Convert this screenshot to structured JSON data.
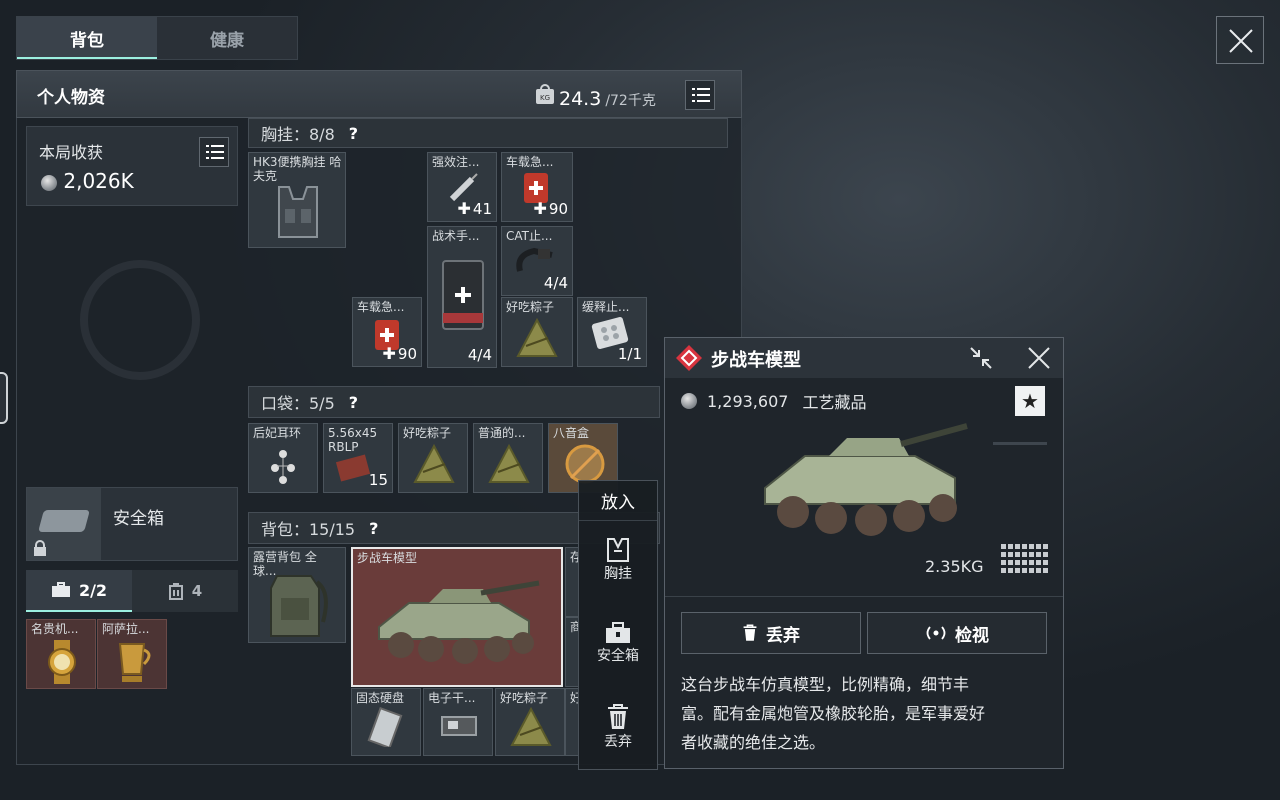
{
  "tabs": {
    "backpack": "背包",
    "health": "健康"
  },
  "header": {
    "title": "个人物资",
    "weight": "24.3",
    "weight_cap": "/72千克",
    "weight_icon": "kg-weight-icon"
  },
  "harvest": {
    "title": "本局收获",
    "value": "2,026K"
  },
  "chest_rig": {
    "label": "胸挂：8/8",
    "help": "?"
  },
  "chest_items": [
    {
      "name": "HK3便携胸挂 哈夫克",
      "count": ""
    },
    {
      "name": "强效注...",
      "count": "41"
    },
    {
      "name": "车载急...",
      "count": "90"
    },
    {
      "name": "战术手...",
      "count": "4/4"
    },
    {
      "name": "CAT止...",
      "count": "4/4"
    },
    {
      "name": "车载急...",
      "count": "90"
    },
    {
      "name": "好吃粽子",
      "count": ""
    },
    {
      "name": "缓释止...",
      "count": "1/1"
    }
  ],
  "pocket": {
    "label": "口袋：5/5",
    "help": "?"
  },
  "pocket_items": [
    {
      "name": "后妃耳环",
      "count": ""
    },
    {
      "name": "5.56x45 RBLP",
      "count": "15"
    },
    {
      "name": "好吃粽子",
      "count": ""
    },
    {
      "name": "普通的...",
      "count": ""
    },
    {
      "name": "八音盒",
      "count": ""
    }
  ],
  "backpack": {
    "label": "背包：15/15",
    "help": "?"
  },
  "backpack_items": [
    {
      "name": "露营背包 全球..."
    },
    {
      "name": "步战车模型"
    },
    {
      "name": "存"
    },
    {
      "name": "商"
    },
    {
      "name": "固态硬盘"
    },
    {
      "name": "电子干..."
    },
    {
      "name": "好吃粽子"
    },
    {
      "name": "好"
    }
  ],
  "safe_box": {
    "label": "安全箱"
  },
  "subtabs": {
    "case": "2/2",
    "bag": "4"
  },
  "valuables": [
    {
      "name": "名贵机..."
    },
    {
      "name": "阿萨拉..."
    }
  ],
  "context_menu": {
    "title": "放入",
    "items": [
      "胸挂",
      "安全箱",
      "丢弃"
    ]
  },
  "detail": {
    "title": "步战车模型",
    "price": "1,293,607",
    "category": "工艺藏品",
    "weight": "2.35KG",
    "discard": "丢弃",
    "inspect": "检视",
    "description_lines": [
      "这台步战车仿真模型，比例精确，细节丰",
      "富。配有金属炮管及橡胶轮胎，是军事爱好",
      "者收藏的绝佳之选。"
    ],
    "accent_color": "#d8343f"
  }
}
